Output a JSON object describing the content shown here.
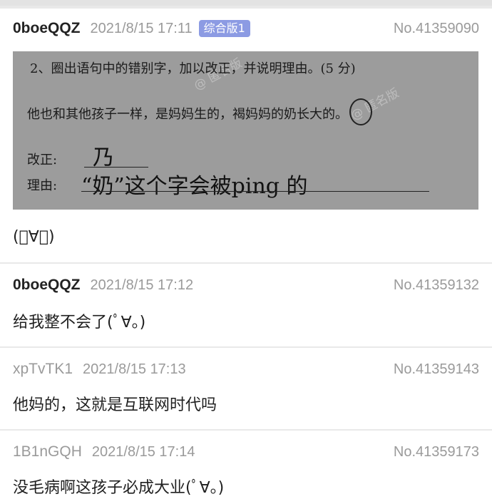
{
  "posts": [
    {
      "uid": "0boeQQZ",
      "time": "2021/8/15 17:11",
      "badge": "综合版1",
      "no": "No.41359090",
      "content": "(ﾟ∀。)",
      "image": {
        "question": "2、圈出语句中的错别字，加以改正，并说明理由。(5 分)",
        "sentence": "他也和其他孩子一样，是妈妈生的，褐妈妈的奶长大的。",
        "fix_label": "改正:",
        "reason_label": "理由:",
        "hand_fix": "乃",
        "hand_reason": "“奶”这个字会被ping 的"
      }
    },
    {
      "uid": "0boeQQZ",
      "time": "2021/8/15 17:12",
      "no": "No.41359132",
      "content": "给我整不会了(ﾟ∀。)"
    },
    {
      "uid": "xpTvTK1",
      "time": "2021/8/15 17:13",
      "no": "No.41359143",
      "content": "他妈的，这就是互联网时代吗"
    },
    {
      "uid": "1B1nGQH",
      "time": "2021/8/15 17:14",
      "no": "No.41359173",
      "content": "没毛病啊这孩子必成大业(ﾟ∀。)"
    }
  ]
}
